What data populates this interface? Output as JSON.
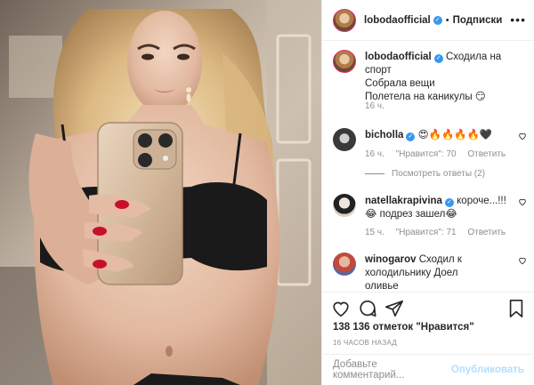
{
  "header": {
    "username": "lobodaofficial",
    "separator": "•",
    "follow_label": "Подписки",
    "more_glyph": "•••"
  },
  "caption": {
    "username": "lobodaofficial",
    "lines": [
      "Сходила на спорт",
      "Собрала вещи",
      "Полетела на каникулы 😏"
    ],
    "time": "16 ч."
  },
  "comments": [
    {
      "username": "bicholla",
      "text": "😍🔥🔥🔥🔥🖤",
      "time": "16 ч.",
      "likes": "\"Нравится\": 70",
      "reply": "Ответить",
      "view_replies": "Посмотреть ответы (2)"
    },
    {
      "username": "natellakrapivina",
      "text": "короче...!!!😂 подрез зашел😂",
      "time": "15 ч.",
      "likes": "\"Нравится\": 71",
      "reply": "Ответить"
    },
    {
      "username": "winogarov",
      "text": "Сходил к холодильнику Доел оливье"
    }
  ],
  "likes_count": "138 136 отметок \"Нравится\"",
  "time_ago": "16 ЧАСОВ НАЗАД",
  "add_comment": {
    "placeholder": "Добавьте комментарий...",
    "publish_label": "Опубликовать"
  },
  "colors": {
    "accent": "#3897f0",
    "muted": "#8e8e8e",
    "publish_disabled": "#b2dffc",
    "divider": "#efefef"
  },
  "icons": [
    "more-icon",
    "verified-icon",
    "heart-icon",
    "comment-icon",
    "share-icon",
    "bookmark-icon"
  ]
}
